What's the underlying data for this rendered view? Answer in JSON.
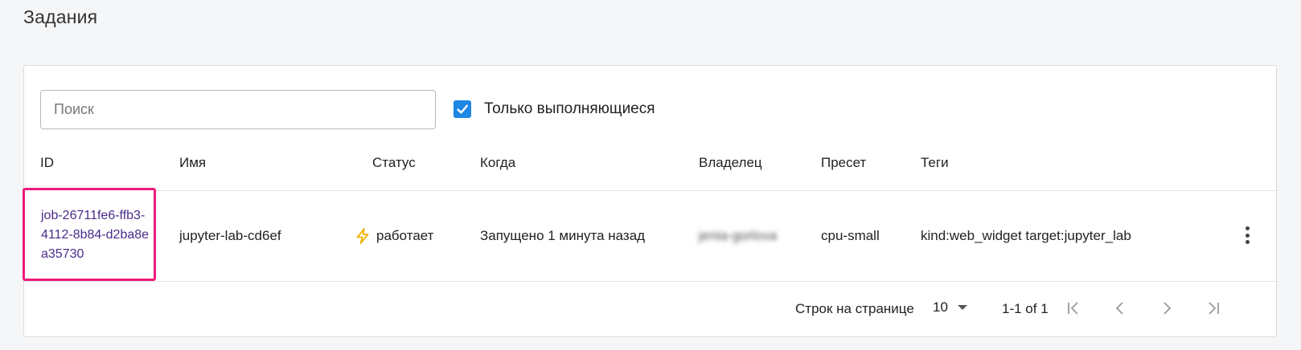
{
  "page": {
    "title": "Задания"
  },
  "filters": {
    "search_placeholder": "Поиск",
    "search_value": "",
    "running_only_label": "Только выполняющиеся",
    "running_only_checked": true
  },
  "table": {
    "columns": [
      "ID",
      "Имя",
      "Статус",
      "Когда",
      "Владелец",
      "Пресет",
      "Теги"
    ],
    "rows": [
      {
        "id": "job-26711fe6-ffb3-4112-8b84-d2ba8ea35730",
        "name": "jupyter-lab-cd6ef",
        "status": "работает",
        "status_icon": "lightning-icon",
        "when": "Запущено 1 минута назад",
        "owner": "jenia-gorlova",
        "preset": "cpu-small",
        "tags": "kind:web_widget target:jupyter_lab"
      }
    ]
  },
  "pagination": {
    "rows_per_page_label": "Строк на странице",
    "rows_per_page": "10",
    "range": "1-1 of 1"
  },
  "colors": {
    "accent": "#1e88e5",
    "link": "#4a2b8a",
    "highlight": "#ee1a7a",
    "status_icon": "#f2b200"
  }
}
